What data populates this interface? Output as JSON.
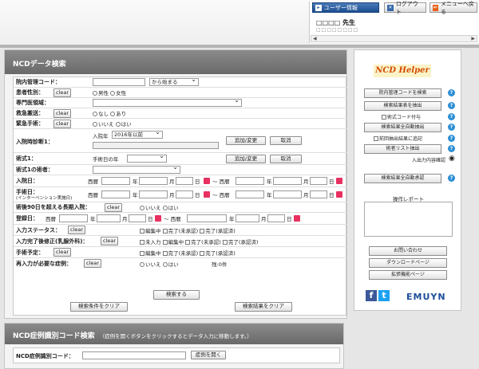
{
  "topbar": {
    "user_tab": "ユーザー情報",
    "logout": "ログアウト",
    "menu": "メニューへ戻る",
    "user_name": "□□□□ 先生",
    "user_sub": "□□□□□□□□"
  },
  "search": {
    "title": "NCDデータ検索",
    "fields": {
      "hospital_code": {
        "label": "院内管理コード：",
        "mode": "から始まる"
      },
      "gender": {
        "label": "患者性別：",
        "clear": "clear",
        "opt1": "男性",
        "opt2": "女性"
      },
      "specialty": {
        "label": "専門医領域："
      },
      "emergency_transport": {
        "label": "救急搬送：",
        "clear": "clear",
        "opt1": "なし",
        "opt2": "あり"
      },
      "emergency_surgery": {
        "label": "緊急手術：",
        "clear": "clear",
        "opt1": "いいえ",
        "opt2": "はい"
      },
      "diagnosis1": {
        "label": "入院時診断1：",
        "year_label": "入院年",
        "year_value": "2016年以前",
        "add": "追加/変更",
        "cancel": "取消"
      },
      "procedure1": {
        "label": "術式1：",
        "year_label": "手術日の年",
        "add": "追加/変更",
        "cancel": "取消"
      },
      "surgeon1": {
        "label": "術式1の術者："
      },
      "admission_date": {
        "label": "入院日：",
        "era": "西暦",
        "y": "年",
        "m": "月",
        "d": "日",
        "tilde": "～ 西暦"
      },
      "surgery_date": {
        "label1": "手術日：",
        "label2": "(インターベンション実施日)",
        "era": "西暦",
        "y": "年",
        "m": "月",
        "d": "日",
        "tilde": "～ 西暦"
      },
      "long_stay": {
        "label": "術後90日を超える長期入院：",
        "clear": "clear",
        "opt1": "いいえ",
        "opt2": "はい"
      },
      "register_date": {
        "label": "登録日：",
        "era": "西暦",
        "y": "年",
        "m": "月",
        "d": "日",
        "tilde": "～ 西暦"
      },
      "input_status": {
        "label": "入力ステータス：",
        "clear": "clear",
        "c1": "編集中",
        "c2": "完了(未承認)",
        "c3": "完了(承認済)"
      },
      "input_complete": {
        "label": "入力完了後修正(乳腺外科)：",
        "clear": "clear",
        "c0": "未入力",
        "c1": "編集中",
        "c2": "完了(未承認)",
        "c3": "完了(承認済)"
      },
      "surgery_plan": {
        "label": "手術予定：",
        "clear": "clear",
        "c1": "編集中",
        "c2": "完了(未承認)",
        "c3": "完了(承認済)"
      },
      "reinput": {
        "label": "再入力が必要な症例：",
        "clear": "clear",
        "opt1": "いいえ",
        "opt2": "はい",
        "remaining": "残:0件"
      }
    },
    "search_button": "検索する",
    "clear_conditions": "検索条件をクリア",
    "clear_results": "検索結果をクリア"
  },
  "case_search": {
    "title": "NCD症例識別コード検索",
    "note": "（症例を開くボタンをクリックするとデータ入力に移動します。）",
    "label": "NCD症例識別コード：",
    "open_button": "症例を開く"
  },
  "helper": {
    "title": "NCD Helper",
    "buttons": [
      "院内管理コードを検索",
      "検索結果表を抽出",
      "検索結果全自動抽出",
      "術者リスト抽出",
      "検索結果全自動承認"
    ],
    "checks": [
      "術式コード付与",
      "前回抽出結果に追記"
    ],
    "io_confirm": "入出力内容確認",
    "report_label": "操作レポート",
    "bottom_buttons": [
      "お問い合わせ",
      "ダウンロードページ",
      "拡張機能ページ"
    ],
    "brand": "EMUYN"
  },
  "colors": {
    "header": "#777777",
    "calendar": "#e83060",
    "helper_title": "#d24a00",
    "accent": "#2d8fd5"
  }
}
